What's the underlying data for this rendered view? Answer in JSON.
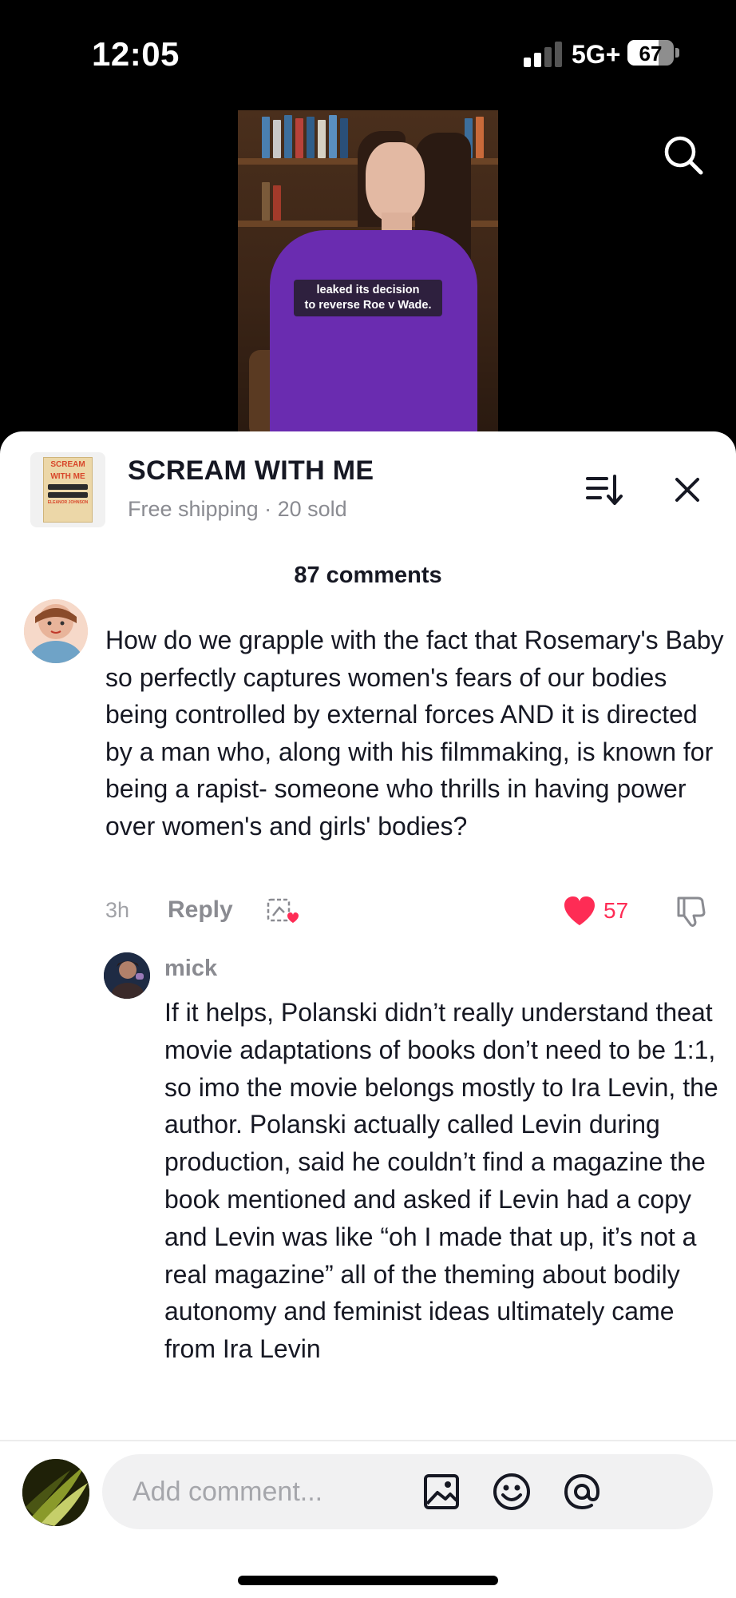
{
  "status_bar": {
    "time": "12:05",
    "network": "5G+",
    "battery_percent": "67",
    "battery_level": 0.67,
    "signal_bars_filled": 2,
    "signal_bars_total": 4
  },
  "video": {
    "caption_line1": "leaked its decision",
    "caption_line2": "to reverse Roe v Wade."
  },
  "icons": {
    "search": "search-icon",
    "sort": "sort-icon",
    "close": "close-icon",
    "gift": "gift-icon",
    "like": "heart-icon",
    "dislike": "thumbs-down-icon",
    "image": "image-icon",
    "emoji": "emoji-icon",
    "mention": "at-icon"
  },
  "product": {
    "title": "SCREAM WITH ME",
    "subtitle": "Free shipping · 20 sold",
    "cover_title_line1": "SCREAM",
    "cover_title_line2": "WITH ME",
    "cover_author": "ELEANOR JOHNSON"
  },
  "comments_header": {
    "count_label": "87 comments"
  },
  "comment": {
    "text": "How do we grapple with the fact that Rosemary's Baby so perfectly captures women's fears of our bodies being controlled by external forces AND it is directed by a man who, along with his filmmaking, is known for being a rapist- someone who thrills in having power over women's and girls' bodies?",
    "time": "3h",
    "reply_label": "Reply",
    "likes": "57"
  },
  "reply": {
    "username": "mick",
    "text": "If it helps, Polanski didn’t really understand theat movie adaptations of books don’t need to be 1:1, so imo the movie belongs mostly to Ira Levin, the author. Polanski actually called Levin during production, said he couldn’t find a magazine the book mentioned and asked if Levin had a copy and Levin was like “oh I made that up, it’s not a real magazine” all of the theming about bodily autonomy and feminist ideas ultimately came from Ira Levin"
  },
  "composer": {
    "placeholder": "Add comment..."
  },
  "colors": {
    "accent_red": "#fe2c55",
    "text_primary": "#161823",
    "text_secondary": "#8a8b91",
    "dress_purple": "#6a2cb0"
  }
}
